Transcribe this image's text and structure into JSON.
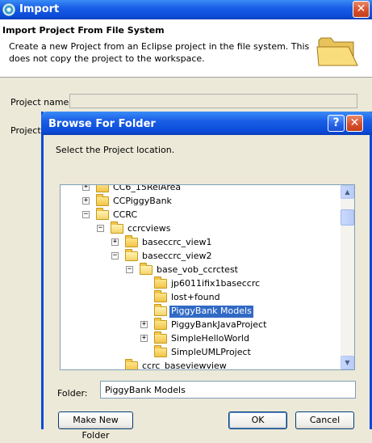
{
  "import_window": {
    "title": "Import",
    "banner_title": "Import Project From File System",
    "banner_description": "Create a new Project from an Eclipse project in the file system. This does not copy the project to the workspace.",
    "project_name_label": "Project name:",
    "project_name_value": "",
    "project_contents_label": "Project"
  },
  "browse_dialog": {
    "title": "Browse For Folder",
    "help_glyph": "?",
    "close_glyph": "✕",
    "prompt": "Select the Project location.",
    "folder_label": "Folder:",
    "folder_value": "PiggyBank Models",
    "make_new_folder_label": "Make New Folder",
    "ok_label": "OK",
    "cancel_label": "Cancel",
    "tree": [
      {
        "label": "CC6_15RelArea",
        "level": 0,
        "expander": "+",
        "open": false,
        "selected": false
      },
      {
        "label": "CCPiggyBank",
        "level": 0,
        "expander": "+",
        "open": false,
        "selected": false
      },
      {
        "label": "CCRC",
        "level": 0,
        "expander": "−",
        "open": true,
        "selected": false
      },
      {
        "label": "ccrcviews",
        "level": 1,
        "expander": "−",
        "open": true,
        "selected": false
      },
      {
        "label": "baseccrc_view1",
        "level": 2,
        "expander": "+",
        "open": false,
        "selected": false
      },
      {
        "label": "baseccrc_view2",
        "level": 2,
        "expander": "−",
        "open": true,
        "selected": false
      },
      {
        "label": "base_vob_ccrctest",
        "level": 3,
        "expander": "−",
        "open": true,
        "selected": false
      },
      {
        "label": "jp6011ifix1baseccrc",
        "level": 4,
        "expander": "",
        "open": false,
        "selected": false
      },
      {
        "label": "lost+found",
        "level": 4,
        "expander": "",
        "open": false,
        "selected": false
      },
      {
        "label": "PiggyBank Models",
        "level": 4,
        "expander": "",
        "open": true,
        "selected": true
      },
      {
        "label": "PiggyBankJavaProject",
        "level": 4,
        "expander": "+",
        "open": false,
        "selected": false
      },
      {
        "label": "SimpleHelloWorld",
        "level": 4,
        "expander": "+",
        "open": false,
        "selected": false
      },
      {
        "label": "SimpleUMLProject",
        "level": 4,
        "expander": "",
        "open": false,
        "selected": false
      },
      {
        "label": "ccrc_baseviewview",
        "level": 2,
        "expander": "",
        "open": false,
        "selected": false
      }
    ]
  },
  "icons": {
    "app": "eclipse-icon",
    "banner": "folder-open-icon",
    "tree_item": "folder-icon"
  },
  "colors": {
    "titlebar_blue": "#0b4bd8",
    "selection_blue": "#316ac5",
    "close_red": "#d6502b",
    "dialog_face": "#ece9d8"
  }
}
